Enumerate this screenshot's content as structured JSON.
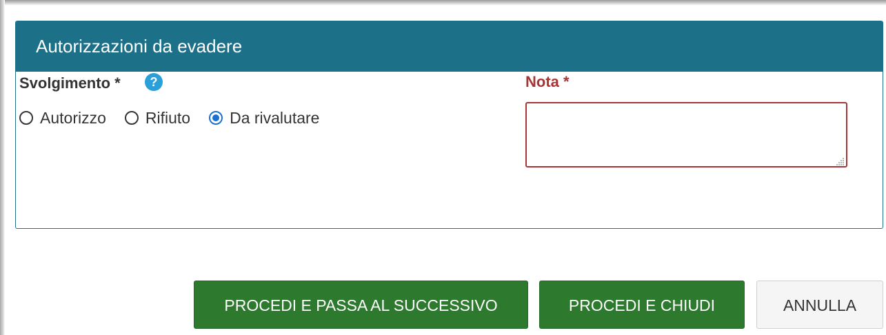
{
  "panel": {
    "title": "Autorizzazioni da evadere"
  },
  "form": {
    "svolgimento_label": "Svolgimento *",
    "help_glyph": "?",
    "options": [
      {
        "label": "Autorizzo",
        "checked": false
      },
      {
        "label": "Rifiuto",
        "checked": false
      },
      {
        "label": "Da rivalutare",
        "checked": true
      }
    ],
    "nota_label": "Nota *",
    "nota_value": "",
    "nota_placeholder": ""
  },
  "buttons": {
    "next_label": "PROCEDI E PASSA AL SUCCESSIVO",
    "close_label": "PROCEDI E CHIUDI",
    "cancel_label": "ANNULLA"
  },
  "colors": {
    "header": "#1c7088",
    "help": "#2a9fd8",
    "required_accent": "#a83434",
    "radio_selected": "#1a6fd0",
    "primary_button": "#2d7a2f"
  },
  "icons": {
    "help": "question-circle-icon",
    "resize": "resize-grip-icon"
  }
}
